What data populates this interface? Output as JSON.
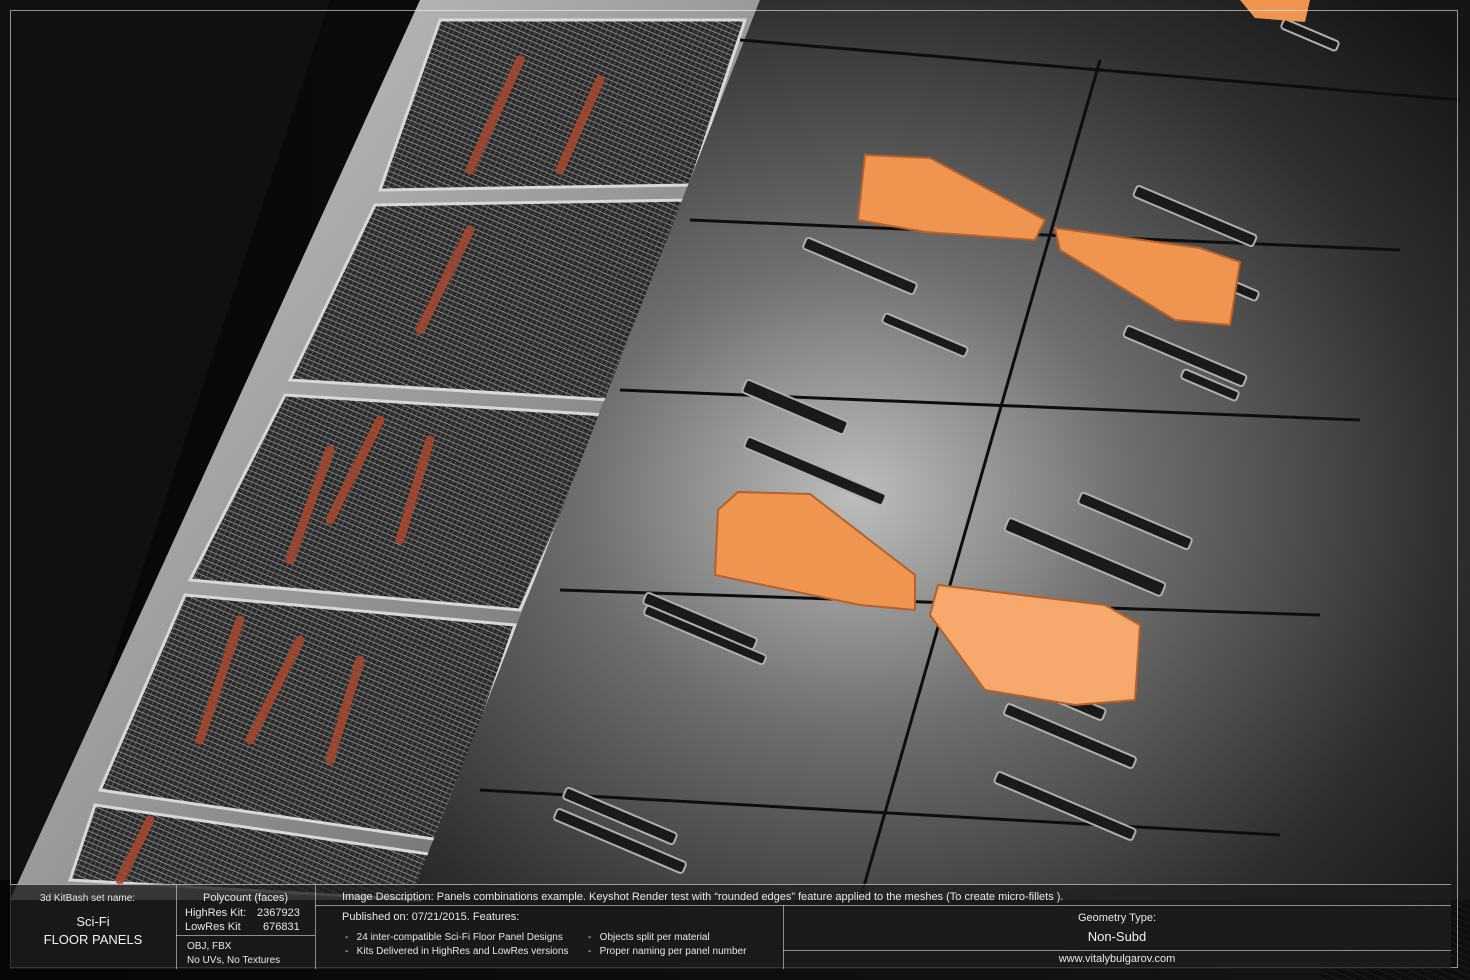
{
  "kitbash": {
    "set_label": "3d KitBash set name:",
    "set_name_line1": "Sci-Fi",
    "set_name_line2": "FLOOR PANELS"
  },
  "polycount": {
    "title": "Polycount (faces)",
    "highres_label": "HighRes Kit:",
    "highres_value": "2367923",
    "lowres_label": "LowRes Kit",
    "lowres_value": "676831"
  },
  "formats": {
    "line1": "OBJ, FBX",
    "line2": "No UVs, No Textures"
  },
  "description": {
    "text": "Image Description: Panels combinations example. Keyshot Render test with “rounded edges” feature applied to the meshes (To create micro-fillets )."
  },
  "published": {
    "text": "Published on: 07/21/2015. Features:"
  },
  "features": [
    "24 inter-compatible Sci-Fi Floor Panel Designs",
    "Kits Delivered in HighRes and LowRes versions",
    "Objects split per material",
    "Proper naming per panel number"
  ],
  "geometry": {
    "label": "Geometry Type:",
    "value": "Non-Subd"
  },
  "website": "www.vitalybulgarov.com",
  "colors": {
    "accent_orange": "#f0954f",
    "panel_dark": "#2b2b2b",
    "grate_metal": "#8a8a8a",
    "pipe_red": "#a8482d"
  }
}
